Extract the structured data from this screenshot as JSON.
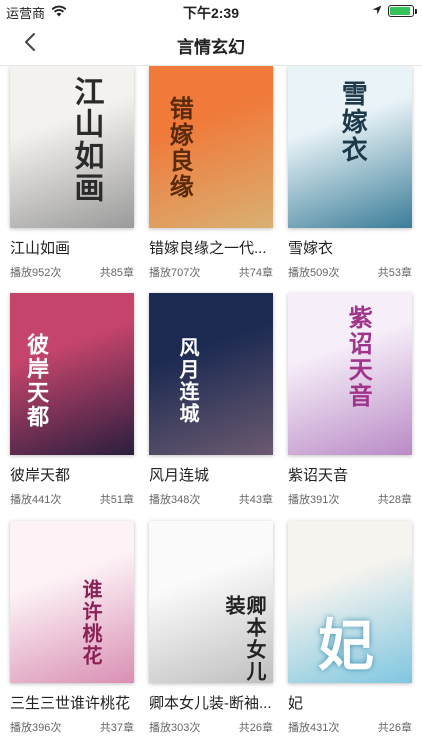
{
  "status": {
    "carrier": "运营商",
    "time": "下午2:39",
    "battery_level": 0.9
  },
  "nav": {
    "title": "言情玄幻"
  },
  "books": [
    {
      "title": "江山如画",
      "plays": "播放952次",
      "chapters": "共85章",
      "cover_text": "江山如画",
      "bg1": "#f4f2ee",
      "bg2": "#9a9a9a",
      "ink": "#2b2b2b"
    },
    {
      "title": "错嫁良缘之一代...",
      "plays": "播放707次",
      "chapters": "共74章",
      "cover_text": "错嫁良缘",
      "bg1": "#f07a3a",
      "bg2": "#d9b073",
      "ink": "#5a2a0a"
    },
    {
      "title": "雪嫁衣",
      "plays": "播放509次",
      "chapters": "共53章",
      "cover_text": "雪嫁衣",
      "bg1": "#eaf4f8",
      "bg2": "#3b7d98",
      "ink": "#1e3a4a"
    },
    {
      "title": "彼岸天都",
      "plays": "播放441次",
      "chapters": "共51章",
      "cover_text": "彼岸天都",
      "bg1": "#c4446b",
      "bg2": "#2a1e3e",
      "ink": "#ffffff"
    },
    {
      "title": "风月连城",
      "plays": "播放348次",
      "chapters": "共43章",
      "cover_text": "风月连城",
      "bg1": "#1c2a52",
      "bg2": "#6b5a70",
      "ink": "#ffffff"
    },
    {
      "title": "紫诏天音",
      "plays": "播放391次",
      "chapters": "共28章",
      "cover_text": "紫诏天音",
      "bg1": "#f6eef8",
      "bg2": "#b98ac6",
      "ink": "#a0348a"
    },
    {
      "title": "三生三世谁许桃花",
      "plays": "播放396次",
      "chapters": "共37章",
      "cover_text": "谁许桃花",
      "bg1": "#fdf3f7",
      "bg2": "#d98fb3",
      "ink": "#8a2055"
    },
    {
      "title": "卿本女儿装-断袖...",
      "plays": "播放303次",
      "chapters": "共26章",
      "cover_text": "卿本女儿装",
      "bg1": "#fbfbfb",
      "bg2": "#bfbfbf",
      "ink": "#222222"
    },
    {
      "title": "妃",
      "plays": "播放431次",
      "chapters": "共26章",
      "cover_text": "妃",
      "bg1": "#f7f4ef",
      "bg2": "#7fc6df",
      "ink": "#ffffff"
    }
  ]
}
